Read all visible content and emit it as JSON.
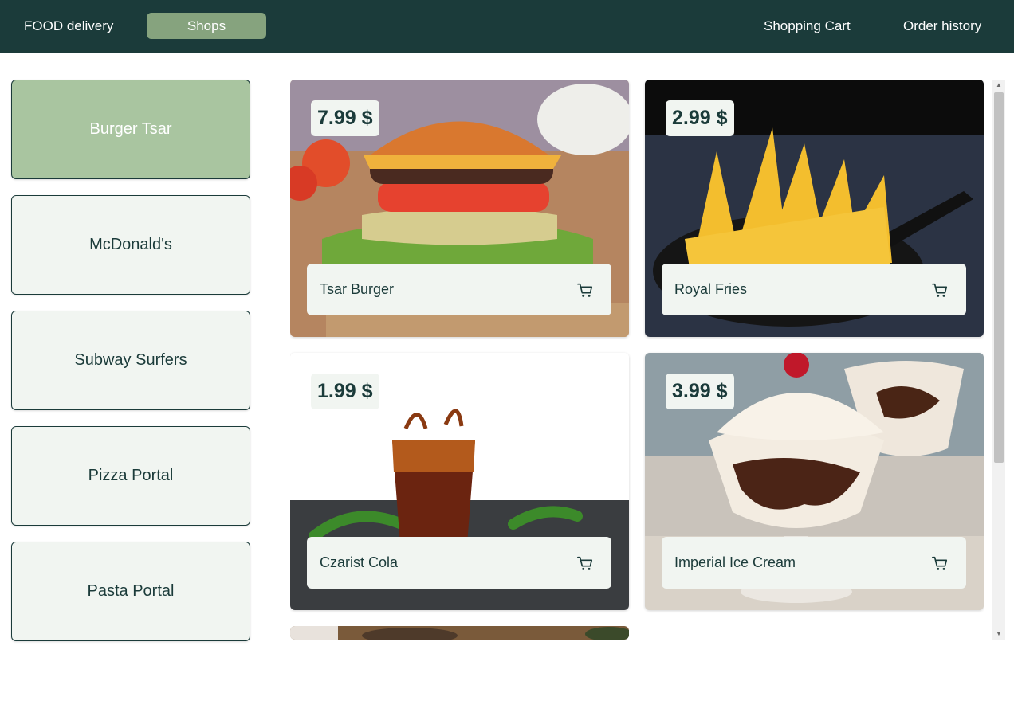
{
  "header": {
    "brand": "FOOD delivery",
    "nav": {
      "shops": "Shops",
      "cart": "Shopping Cart",
      "history": "Order history"
    }
  },
  "shops": [
    {
      "label": "Burger Tsar",
      "active": true
    },
    {
      "label": "McDonald's",
      "active": false
    },
    {
      "label": "Subway Surfers",
      "active": false
    },
    {
      "label": "Pizza Portal",
      "active": false
    },
    {
      "label": "Pasta Portal",
      "active": false
    }
  ],
  "products": [
    {
      "name": "Tsar Burger",
      "price": "7.99 $",
      "image": "burger-photo"
    },
    {
      "name": "Royal Fries",
      "price": "2.99 $",
      "image": "fries-photo"
    },
    {
      "name": "Czarist Cola",
      "price": "1.99 $",
      "image": "cola-photo"
    },
    {
      "name": "Imperial Ice Cream",
      "price": "3.99 $",
      "image": "ice-cream-photo"
    }
  ],
  "icons": {
    "add_to_cart": "cart-icon",
    "scroll_up": "triangle-up-icon",
    "scroll_down": "triangle-down-icon"
  },
  "colors": {
    "header_bg": "#1b3b3a",
    "accent": "#86a37e",
    "active_shop": "#a9c5a0",
    "surface": "#f1f5f1",
    "text": "#1b3b3a"
  }
}
